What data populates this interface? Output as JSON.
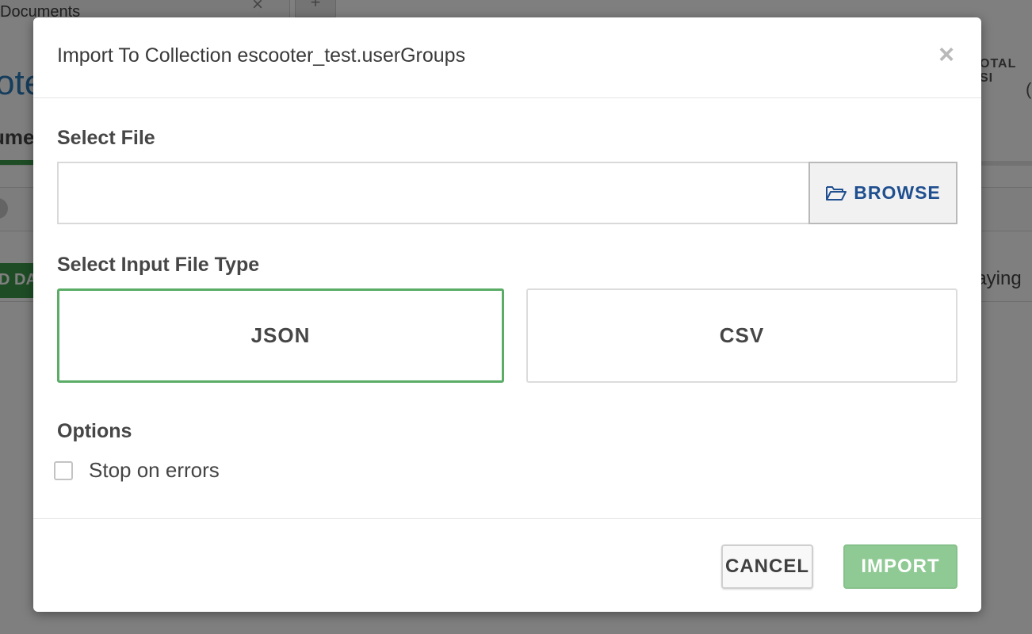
{
  "background": {
    "tab_label": "Documents",
    "tab_close": "×",
    "tab_add": "+",
    "collection_title_fragment": "ote",
    "docs_tab_fragment": "ume",
    "add_data_fragment": "D DA",
    "total_label_fragment": "OTAL SI",
    "total_value_fragment": "(",
    "displaying_fragment": "laying"
  },
  "modal": {
    "title": "Import To Collection escooter_test.userGroups",
    "close_glyph": "×",
    "select_file": {
      "label": "Select File",
      "input_value": "",
      "browse_label": "BROWSE"
    },
    "file_type": {
      "label": "Select Input File Type",
      "options": [
        {
          "label": "JSON",
          "selected": true
        },
        {
          "label": "CSV",
          "selected": false
        }
      ]
    },
    "options": {
      "label": "Options",
      "stop_on_errors_label": "Stop on errors",
      "stop_on_errors_checked": false
    },
    "footer": {
      "cancel_label": "CANCEL",
      "import_label": "IMPORT"
    }
  },
  "colors": {
    "accent_green": "#5aac66",
    "import_button": "#8fca94",
    "browse_text": "#1f4f8f"
  },
  "icons": {
    "browse": "folder-open-icon",
    "close": "close-icon"
  }
}
